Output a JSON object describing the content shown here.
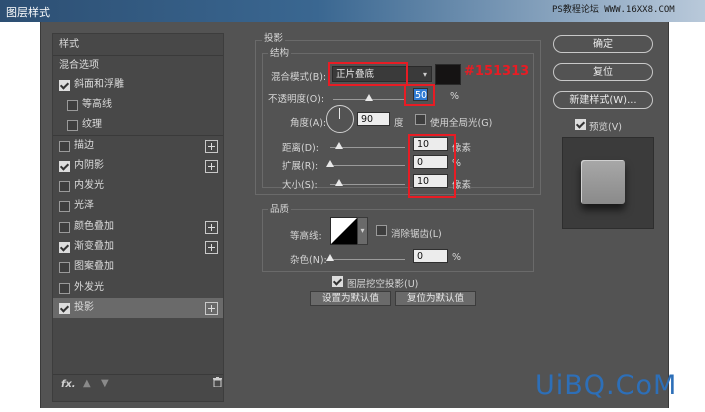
{
  "window": {
    "title": "图层样式"
  },
  "watermark_top": "PS教程论坛 WWW.16XX8.COM",
  "sidebar": {
    "items": [
      {
        "label": "样式",
        "checkbox": false,
        "checked": false,
        "plus": false
      },
      {
        "label": "混合选项",
        "checkbox": false,
        "checked": false,
        "plus": false
      },
      {
        "label": "斜面和浮雕",
        "checkbox": true,
        "checked": true,
        "plus": false
      },
      {
        "label": "等高线",
        "checkbox": true,
        "checked": false,
        "plus": false
      },
      {
        "label": "纹理",
        "checkbox": true,
        "checked": false,
        "plus": false
      },
      {
        "label": "描边",
        "checkbox": true,
        "checked": false,
        "plus": true
      },
      {
        "label": "内阴影",
        "checkbox": true,
        "checked": true,
        "plus": true
      },
      {
        "label": "内发光",
        "checkbox": true,
        "checked": false,
        "plus": false
      },
      {
        "label": "光泽",
        "checkbox": true,
        "checked": false,
        "plus": false
      },
      {
        "label": "颜色叠加",
        "checkbox": true,
        "checked": false,
        "plus": true
      },
      {
        "label": "渐变叠加",
        "checkbox": true,
        "checked": true,
        "plus": true
      },
      {
        "label": "图案叠加",
        "checkbox": true,
        "checked": false,
        "plus": false
      },
      {
        "label": "外发光",
        "checkbox": true,
        "checked": false,
        "plus": false
      },
      {
        "label": "投影",
        "checkbox": true,
        "checked": true,
        "plus": true,
        "selected": true
      }
    ],
    "footer_fx": "fx."
  },
  "shadow": {
    "section_title": "投影",
    "structure_title": "结构",
    "blend_mode_label": "混合模式(B):",
    "blend_mode_value": "正片叠底",
    "color_swatch": "#151313",
    "color_annotation": "#151313",
    "opacity_label": "不透明度(O):",
    "opacity_value": "50",
    "opacity_unit": "%",
    "angle_label": "角度(A):",
    "angle_value": "90",
    "angle_unit": "度",
    "global_light_label": "使用全局光(G)",
    "distance_label": "距离(D):",
    "distance_value": "10",
    "distance_unit": "像素",
    "spread_label": "扩展(R):",
    "spread_value": "0",
    "spread_unit": "%",
    "size_label": "大小(S):",
    "size_value": "10",
    "size_unit": "像素",
    "quality_title": "品质",
    "contour_label": "等高线:",
    "antialias_label": "消除锯齿(L)",
    "noise_label": "杂色(N):",
    "noise_value": "0",
    "noise_unit": "%",
    "knockout_label": "图层挖空投影(U)",
    "set_default_label": "设置为默认值",
    "reset_default_label": "复位为默认值"
  },
  "buttons": {
    "ok": "确定",
    "reset": "复位",
    "new_style": "新建样式(W)...",
    "preview": "预览(V)"
  },
  "watermark_bottom": "UiBQ.CoM"
}
